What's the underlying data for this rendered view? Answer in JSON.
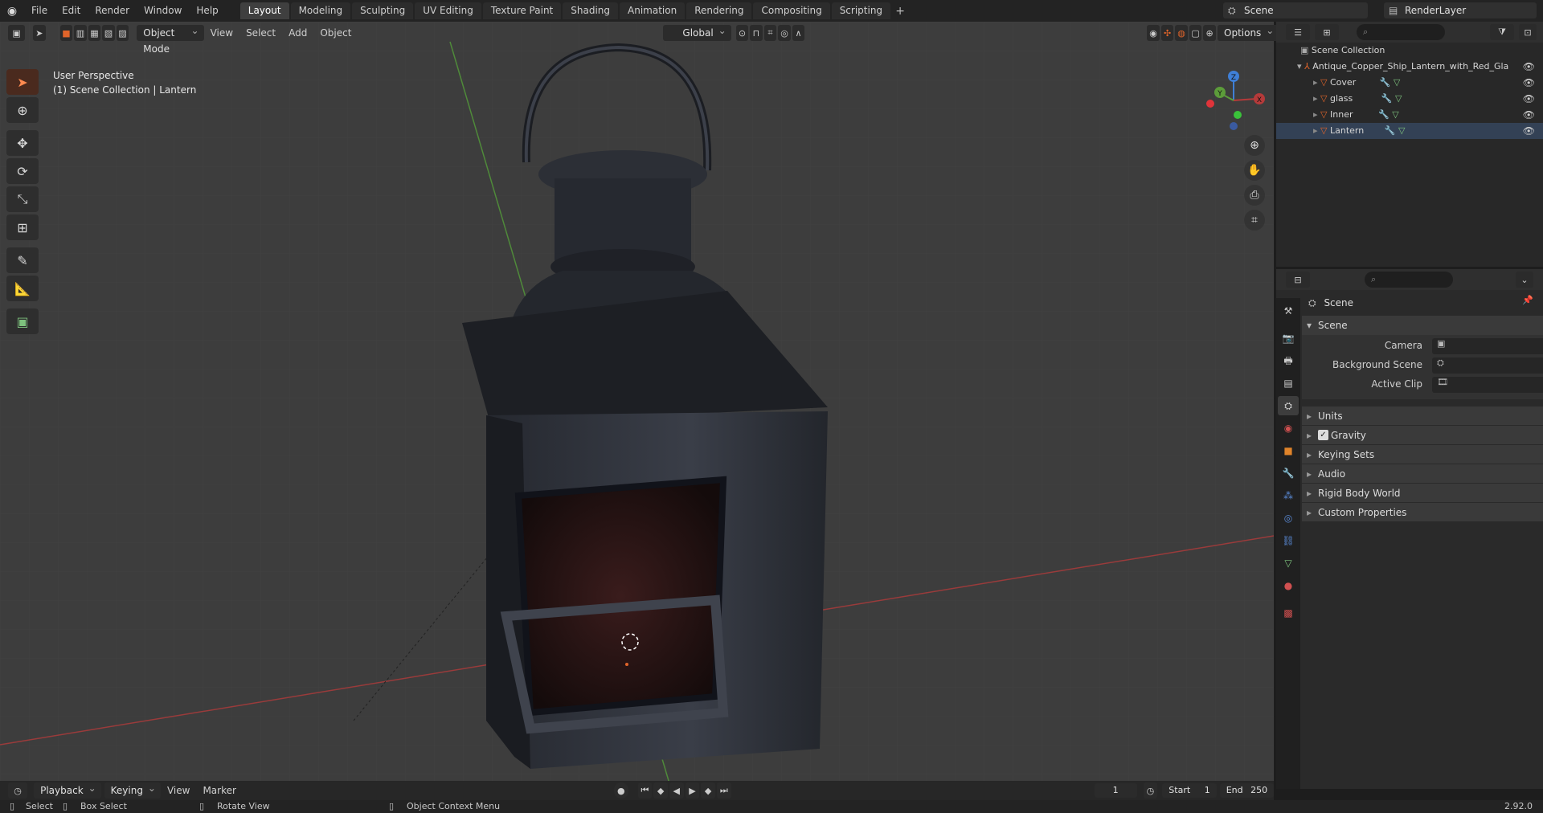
{
  "topbar": {
    "menus": [
      "File",
      "Edit",
      "Render",
      "Window",
      "Help"
    ],
    "workspaces": [
      "Layout",
      "Modeling",
      "Sculpting",
      "UV Editing",
      "Texture Paint",
      "Shading",
      "Animation",
      "Rendering",
      "Compositing",
      "Scripting"
    ],
    "active_workspace": "Layout",
    "scene_name": "Scene",
    "view_layer": "RenderLayer"
  },
  "viewport_header": {
    "mode": "Object Mode",
    "menus": [
      "View",
      "Select",
      "Add",
      "Object"
    ],
    "orientation": "Global",
    "options_label": "Options"
  },
  "viewport_info": {
    "perspective": "User Perspective",
    "context": "(1) Scene Collection | Lantern"
  },
  "gizmo": {
    "x": "X",
    "y": "Y",
    "z": "Z"
  },
  "outliner": {
    "root": "Scene Collection",
    "collection": "Antique_Copper_Ship_Lantern_with_Red_Gla",
    "objects": [
      "Cover",
      "glass",
      "Inner",
      "Lantern"
    ]
  },
  "properties": {
    "context_title": "Scene",
    "panel_title": "Scene",
    "fields": [
      "Camera",
      "Background Scene",
      "Active Clip"
    ],
    "subpanels": [
      "Units",
      "Gravity",
      "Keying Sets",
      "Audio",
      "Rigid Body World",
      "Custom Properties"
    ],
    "gravity_checked": true
  },
  "timeline": {
    "menus": [
      "Playback",
      "Keying",
      "View",
      "Marker"
    ],
    "current_frame": "1",
    "start_label": "Start",
    "start_value": "1",
    "end_label": "End",
    "end_value": "250"
  },
  "statusbar": {
    "select": "Select",
    "box_select": "Box Select",
    "rotate_view": "Rotate View",
    "context_menu": "Object Context Menu",
    "version": "2.92.0"
  },
  "colors": {
    "accent": "#e0642a",
    "axis_x": "#b53a3a",
    "axis_y": "#5c9c3a",
    "axis_z": "#3f7fd6"
  }
}
